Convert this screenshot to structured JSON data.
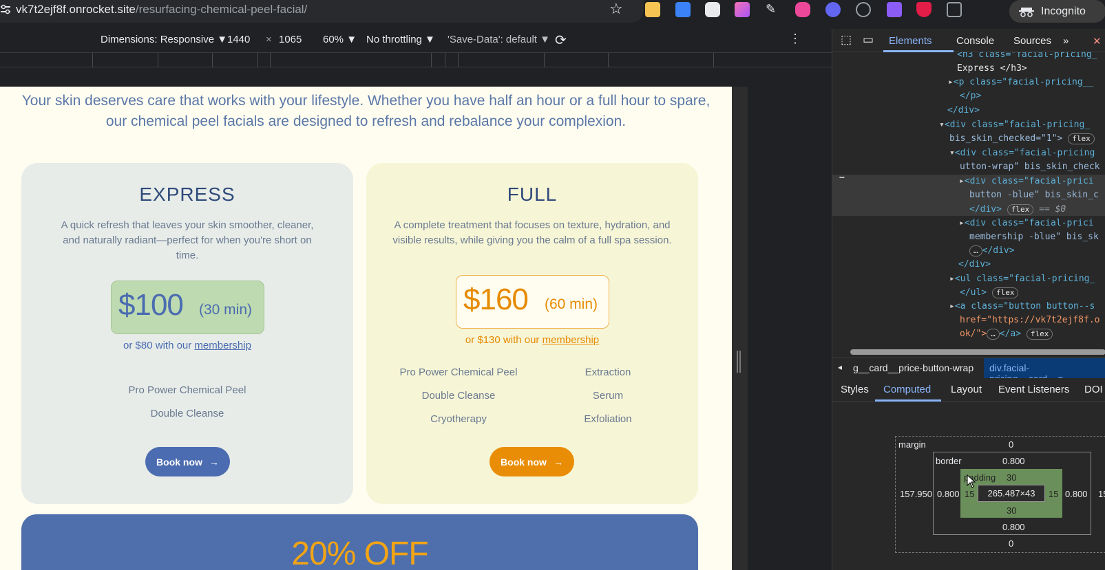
{
  "browser": {
    "url_host": "vk7t2ejf8f.onrocket.site",
    "url_path": "/resurfacing-chemical-peel-facial/",
    "incognito_label": "Incognito"
  },
  "device_toolbar": {
    "dimensions_label": "Dimensions: Responsive ▼",
    "width": "1440",
    "times": "×",
    "height": "1065",
    "zoom": "60% ▼",
    "throttling": "No throttling ▼",
    "save_data": "'Save-Data': default ▼"
  },
  "page": {
    "intro": "Your skin deserves care that works with your lifestyle. Whether you have half an hour or a full hour to spare, our chemical peel facials are designed to refresh and rebalance your complexion.",
    "express": {
      "title": "EXPRESS",
      "description": "A quick refresh that leaves your skin smoother, cleaner, and naturally radiant—perfect for when you're short on time.",
      "price": "$100",
      "duration": "(30 min)",
      "member_prefix": "or $80 with our ",
      "member_link": "membership",
      "features": [
        "Pro Power Chemical Peel",
        "Double Cleanse"
      ],
      "button": "Book now"
    },
    "full": {
      "title": "FULL",
      "description": "A complete treatment that focuses on texture, hydration, and visible results, while giving you the calm of a full spa session.",
      "price": "$160",
      "duration": "(60 min)",
      "member_prefix": "or $130 with our ",
      "member_link": "membership",
      "features_left": [
        "Pro Power Chemical Peel",
        "Double Cleanse",
        "Cryotherapy"
      ],
      "features_right": [
        "Extraction",
        "Serum",
        "Exfoliation"
      ],
      "button": "Book now"
    },
    "promo": "20% OFF"
  },
  "devtools": {
    "tabs": [
      "Elements",
      "Console",
      "Sources"
    ],
    "more": "»",
    "code_lines": [
      "<h3 class=\"facial-pricing_",
      "Express </h3>",
      "<p class=\"facial-pricing__",
      "</p>",
      "</div>",
      "<div class=\"facial-pricing_",
      "bis_skin_checked=\"1\">",
      "<div class=\"facial-pricing",
      "utton-wrap\" bis_skin_check",
      "<div class=\"facial-prici",
      "button -blue\" bis_skin_c",
      "</div>",
      "== $0",
      "<div class=\"facial-prici",
      "membership -blue\" bis_sk",
      "</div>",
      "</div>",
      "<ul class=\"facial-pricing_",
      "</ul>",
      "<a class=\"button button--s",
      "href=\"https://vk7t2ejf8f.o",
      "ok/\">",
      "</a>"
    ],
    "badge": "flex",
    "breadcrumbs": [
      "g__card__price-button-wrap",
      "div.facial-pricing__card__p"
    ],
    "sub_tabs": [
      "Styles",
      "Computed",
      "Layout",
      "Event Listeners",
      "DOI"
    ],
    "box_model": {
      "margin_label": "margin",
      "margin_top": "0",
      "margin_bottom": "0",
      "margin_left": "157.950",
      "margin_right": "15",
      "border_label": "border",
      "border_top": "0.800",
      "border_bottom": "0.800",
      "border_left": "0.800",
      "border_right": "0.800",
      "padding_label": "padding",
      "padding_top": "30",
      "padding_bottom": "30",
      "padding_left": "15",
      "padding_right": "15",
      "content": "265.487×43"
    }
  },
  "colors": {
    "express_accent": "#4b6cb0",
    "full_accent": "#ea8d06",
    "page_bg": "#fefdf0",
    "promo_bg": "#4e6fab"
  }
}
